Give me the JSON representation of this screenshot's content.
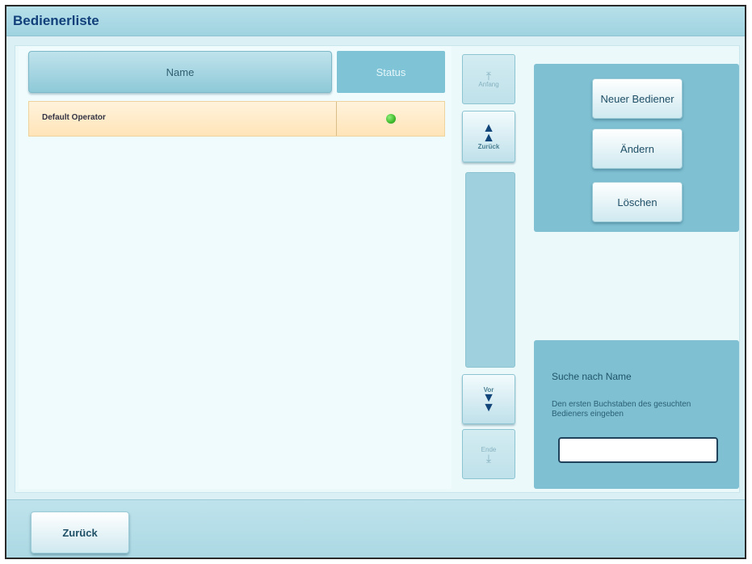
{
  "window": {
    "title": "Bedienerliste"
  },
  "list": {
    "columns": {
      "name": "Name",
      "status": "Status"
    },
    "rows": [
      {
        "name": "Default Operator",
        "status_icon": "green-status-dot-icon"
      }
    ]
  },
  "scroll": {
    "start_label": "Anfang",
    "back_label": "Zurück",
    "forward_label": "Vor",
    "end_label": "Ende"
  },
  "actions": {
    "new_label": "Neuer Bediener",
    "edit_label": "Ändern",
    "delete_label": "Löschen"
  },
  "search": {
    "title": "Suche nach Name",
    "hint": "Den ersten Buchstaben des gesuchten Bedieners eingeben",
    "value": ""
  },
  "footer": {
    "back_label": "Zurück"
  },
  "colors": {
    "title_text": "#12407a",
    "panel": "#7fc0d3",
    "row_highlight": "#ffe4b8",
    "status_ok": "#3fba2c"
  }
}
